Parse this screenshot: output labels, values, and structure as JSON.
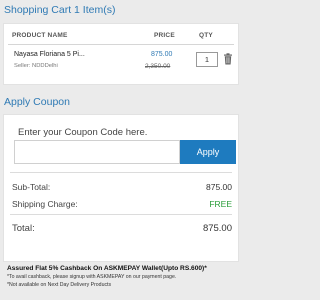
{
  "cart": {
    "title": "Shopping Cart 1 Item(s)",
    "headers": {
      "product": "PRODUCT NAME",
      "price": "PRICE",
      "qty": "QTY"
    },
    "item": {
      "name": "Nayasa Floriana 5 Pi...",
      "seller": "Seller: NDDDelhi",
      "price": "875.00",
      "mrp": "2,350.00",
      "qty": "1"
    }
  },
  "coupon": {
    "title": "Apply Coupon",
    "prompt": "Enter your Coupon Code here.",
    "input_value": "",
    "apply_label": "Apply"
  },
  "summary": {
    "subtotal_label": "Sub-Total:",
    "subtotal_value": "875.00",
    "shipping_label": "Shipping Charge:",
    "shipping_value": "FREE",
    "total_label": "Total:",
    "total_value": "875.00"
  },
  "promo": {
    "headline": "Assured Flat 5% Cashback On ASKMEPAY Wallet(Upto RS.600)*",
    "note1": "*To avail cashback, please signup with ASKMEPAY on our payment page.",
    "note2": "*Not available on Next Day Delivery Products"
  },
  "colors": {
    "accent": "#2f7ab4",
    "button": "#1e7bbf",
    "free": "#2a9d3a"
  }
}
